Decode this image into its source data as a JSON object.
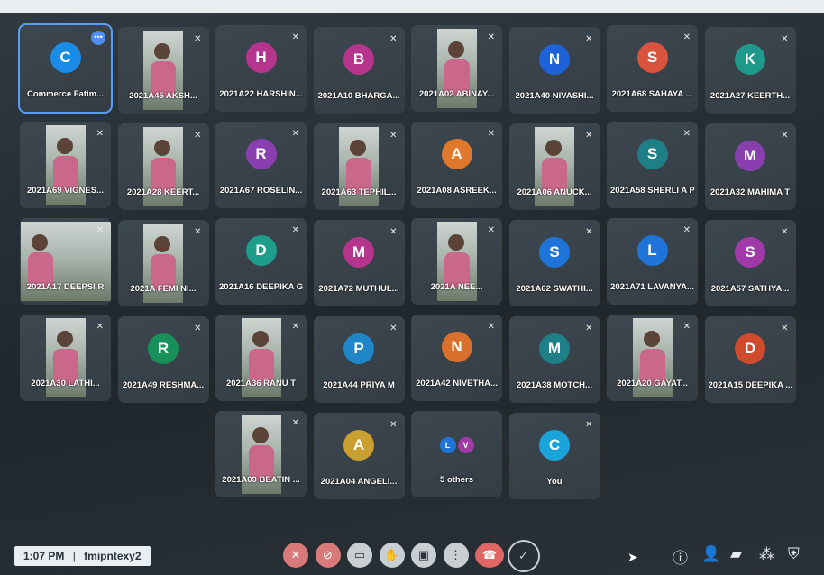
{
  "participants": [
    {
      "name": "Commerce Fatim...",
      "initial": "C",
      "color": "#1a8be6",
      "selected": true
    },
    {
      "name": "2021A45 AKSH...",
      "photo": true
    },
    {
      "name": "2021A22 HARSHIN...",
      "initial": "H",
      "color": "#b5358c"
    },
    {
      "name": "2021A10 BHARGA...",
      "initial": "B",
      "color": "#b5358c"
    },
    {
      "name": "2021A02 ABINAY...",
      "photo": true
    },
    {
      "name": "2021A40 NIVASHI...",
      "initial": "N",
      "color": "#1d62d8"
    },
    {
      "name": "2021A68 SAHAYA ...",
      "initial": "S",
      "color": "#d9543c"
    },
    {
      "name": "2021A27 KEERTH...",
      "initial": "K",
      "color": "#1f9a8a"
    },
    {
      "name": "2021A69 VIGNES...",
      "photo": true
    },
    {
      "name": "2021A28 KEERT...",
      "photo": true
    },
    {
      "name": "2021A67 ROSELIN...",
      "initial": "R",
      "color": "#8a3fb0"
    },
    {
      "name": "2021A63 TEPHIL...",
      "photo": true
    },
    {
      "name": "2021A08 ASREEK...",
      "initial": "A",
      "color": "#e0782c"
    },
    {
      "name": "2021A06 ANUCK...",
      "photo": true
    },
    {
      "name": "2021A58 SHERLI A P",
      "initial": "S",
      "color": "#1f7f86"
    },
    {
      "name": "2021A32 MAHIMA T",
      "initial": "M",
      "color": "#8a3fb0"
    },
    {
      "name": "2021A17 DEEPSI R",
      "photo": true,
      "wide": true
    },
    {
      "name": "2021A FEMI NI...",
      "photo": true
    },
    {
      "name": "2021A16 DEEPIKA G",
      "initial": "D",
      "color": "#1d9d8a"
    },
    {
      "name": "2021A72 MUTHUL...",
      "initial": "M",
      "color": "#b5358c"
    },
    {
      "name": "2021A NEE...",
      "photo": true
    },
    {
      "name": "2021A62 SWATHI...",
      "initial": "S",
      "color": "#1e74d8"
    },
    {
      "name": "2021A71 LAVANYA...",
      "initial": "L",
      "color": "#1e74d8"
    },
    {
      "name": "2021A57 SATHYA...",
      "initial": "S",
      "color": "#a03aa8"
    },
    {
      "name": "2021A30 LATHI...",
      "photo": true
    },
    {
      "name": "2021A49 RESHMA...",
      "initial": "R",
      "color": "#17905a"
    },
    {
      "name": "2021A36 RANU T",
      "photo": true
    },
    {
      "name": "2021A44 PRIYA M",
      "initial": "P",
      "color": "#1f86c8"
    },
    {
      "name": "2021A42 NIVETHA...",
      "initial": "N",
      "color": "#d9702c"
    },
    {
      "name": "2021A38 MOTCH...",
      "initial": "M",
      "color": "#1f7f86"
    },
    {
      "name": "2021A20 GAYAT...",
      "photo": true
    },
    {
      "name": "2021A15 DEEPIKA ...",
      "initial": "D",
      "color": "#d04a2e"
    },
    {
      "name": "2021A09 BEATIN ...",
      "photo": true
    },
    {
      "name": "2021A04 ANGELI...",
      "initial": "A",
      "color": "#c9a030"
    },
    {
      "name": "5 others",
      "others": true
    },
    {
      "name": "You",
      "initial": "C",
      "color": "#1aa3d8"
    }
  ],
  "others_avatars": [
    {
      "initial": "L",
      "color": "#1e74d8"
    },
    {
      "initial": "V",
      "color": "#a03aa8"
    }
  ],
  "meeting": {
    "time": "1:07 PM",
    "code": "fmipntexy2",
    "separator": "|"
  },
  "controls": [
    {
      "name": "mic-off-button",
      "glyph": "✕",
      "style": ""
    },
    {
      "name": "camera-off-button",
      "glyph": "⊘",
      "style": ""
    },
    {
      "name": "captions-button",
      "glyph": "▭",
      "style": "grey"
    },
    {
      "name": "raise-hand-button",
      "glyph": "✋",
      "style": "grey"
    },
    {
      "name": "present-button",
      "glyph": "▣",
      "style": "grey"
    },
    {
      "name": "more-options-button",
      "glyph": "⋮",
      "style": "grey"
    },
    {
      "name": "leave-call-button",
      "glyph": "☎",
      "style": "end"
    },
    {
      "name": "check-button",
      "glyph": "✓",
      "style": "ring"
    }
  ],
  "right_icons": [
    {
      "name": "info-icon",
      "glyph": "ⓘ"
    },
    {
      "name": "people-icon",
      "glyph": "👤"
    },
    {
      "name": "chat-icon",
      "glyph": "▰"
    },
    {
      "name": "activities-icon",
      "glyph": "⁂"
    },
    {
      "name": "host-controls-icon",
      "glyph": "⛨"
    }
  ]
}
